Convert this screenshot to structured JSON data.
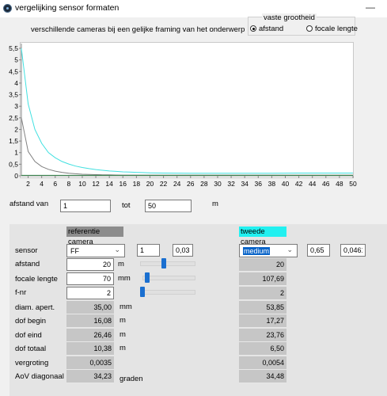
{
  "window": {
    "title": "vergelijking sensor formaten",
    "app_icon": "camera-lens-icon"
  },
  "subtitle": "verschillende cameras bij een gelijke framing van het onderwerp",
  "vaste_grootheid": {
    "title": "vaste grootheid",
    "options": [
      "afstand",
      "focale lengte"
    ],
    "selected": "afstand"
  },
  "chart_data": {
    "type": "line",
    "x": [
      1,
      2,
      3,
      4,
      5,
      6,
      7,
      8,
      9,
      10,
      11,
      12,
      13,
      14,
      15,
      16,
      17,
      18,
      19,
      20,
      22,
      24,
      26,
      28,
      30,
      32,
      34,
      36,
      38,
      40,
      42,
      44,
      46,
      48,
      50
    ],
    "xlim": [
      1,
      50
    ],
    "ylim": [
      0,
      5.5
    ],
    "xticks": [
      "2",
      "4",
      "6",
      "8",
      "10",
      "12",
      "14",
      "16",
      "18",
      "20",
      "22",
      "24",
      "26",
      "28",
      "30",
      "32",
      "34",
      "36",
      "38",
      "40",
      "42",
      "44",
      "46",
      "48",
      "50"
    ],
    "yticks": [
      "0",
      "0,5",
      "1",
      "1,5",
      "2",
      "2,5",
      "3",
      "3,5",
      "4",
      "4,5",
      "5",
      "5,5"
    ],
    "series": [
      {
        "color": "#40e0e0",
        "values": [
          5.5,
          3.1,
          2.0,
          1.4,
          1.0,
          0.78,
          0.62,
          0.51,
          0.42,
          0.36,
          0.31,
          0.27,
          0.24,
          0.21,
          0.19,
          0.17,
          0.16,
          0.15,
          0.14,
          0.13,
          0.12,
          0.115,
          0.11,
          0.11,
          0.11,
          0.11,
          0.11,
          0.11,
          0.11,
          0.115,
          0.12,
          0.12,
          0.12,
          0.12,
          0.12
        ]
      },
      {
        "color": "#808080",
        "values": [
          2.5,
          1.05,
          0.62,
          0.4,
          0.28,
          0.2,
          0.15,
          0.11,
          0.09,
          0.07,
          0.06,
          0.05,
          0.045,
          0.04,
          0.035,
          0.03,
          0.03,
          0.03,
          0.03,
          0.03,
          0.03,
          0.03,
          0.03,
          0.03,
          0.03,
          0.03,
          0.03,
          0.03,
          0.03,
          0.03,
          0.03,
          0.03,
          0.03,
          0.03,
          0.03
        ]
      },
      {
        "color": "#3a8a50",
        "values": [
          0.02,
          0.02,
          0.02,
          0.02,
          0.02,
          0.02,
          0.02,
          0.02,
          0.02,
          0.02,
          0.02,
          0.02,
          0.02,
          0.02,
          0.02,
          0.02,
          0.02,
          0.02,
          0.02,
          0.02,
          0.02,
          0.02,
          0.02,
          0.02,
          0.02,
          0.02,
          0.02,
          0.02,
          0.02,
          0.02,
          0.02,
          0.02,
          0.02,
          0.02,
          0.02
        ]
      }
    ],
    "grid": false,
    "legend": "none"
  },
  "range": {
    "label_van": "afstand van",
    "van_value": "1",
    "label_tot": "tot",
    "tot_value": "50",
    "unit": "m"
  },
  "ref_header": "referentie camera",
  "second_header": "tweede camera",
  "rows": {
    "sensor": {
      "label": "sensor",
      "ref_select": "FF",
      "ref_a": "1",
      "ref_b": "0,03",
      "sec_select": "medium",
      "sec_a": "0,65",
      "sec_b": "0,04615"
    },
    "afstand": {
      "label": "afstand",
      "ref": "20",
      "unit": "m",
      "sec": "20"
    },
    "focale": {
      "label": "focale lengte",
      "ref": "70",
      "unit": "mm",
      "sec": "107,69"
    },
    "fnr": {
      "label": "f-nr",
      "ref": "2",
      "sec": "2"
    },
    "diam": {
      "label": "diam. apert.",
      "ref": "35,00",
      "unit": "mm",
      "sec": "53,85"
    },
    "dofbegin": {
      "label": "dof begin",
      "ref": "16,08",
      "unit": "m",
      "sec": "17,27"
    },
    "dofeind": {
      "label": "dof eind",
      "ref": "26,46",
      "unit": "m",
      "sec": "23,76"
    },
    "doftotaal": {
      "label": "dof totaal",
      "ref": "10,38",
      "unit": "m",
      "sec": "6,50"
    },
    "vergroting": {
      "label": "vergroting",
      "ref": "0,0035",
      "sec": "0,0054"
    },
    "aov": {
      "label": "AoV diagonaal",
      "ref": "34,23",
      "unit": "graden",
      "sec": "34,48"
    }
  },
  "sliders": {
    "afstand_level": 0.42,
    "focale_level": 0.05,
    "fnr_level": 0.0
  },
  "colors": {
    "accent": "#1a6fd0",
    "second_header_bg": "#22f0f0",
    "ref_header_bg": "#8c8c8c"
  }
}
